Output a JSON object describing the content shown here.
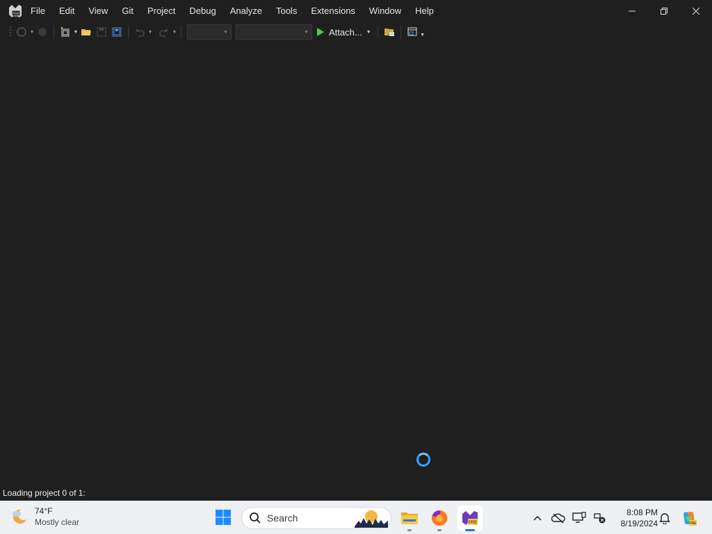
{
  "menu": {
    "items": [
      "File",
      "Edit",
      "View",
      "Git",
      "Project",
      "Debug",
      "Analyze",
      "Tools",
      "Extensions",
      "Window",
      "Help"
    ]
  },
  "toolbar": {
    "attach_label": "Attach...",
    "configuration_value": "",
    "platform_value": ""
  },
  "status": {
    "text": "Loading project 0 of 1:"
  },
  "taskbar": {
    "weather_temp": "74°F",
    "weather_desc": "Mostly clear",
    "search_placeholder": "Search",
    "clock_time": "8:08 PM",
    "clock_date": "8/19/2024"
  },
  "colors": {
    "background": "#1f1f1f",
    "accent": "#3aa0ff",
    "play_green": "#4ec94e",
    "taskbar": "#eef0f4",
    "vs_purple": "#6c3bbf"
  },
  "icons": {
    "app_logo": "visual-studio-preview-logo",
    "spinner": "loading-spinner"
  }
}
